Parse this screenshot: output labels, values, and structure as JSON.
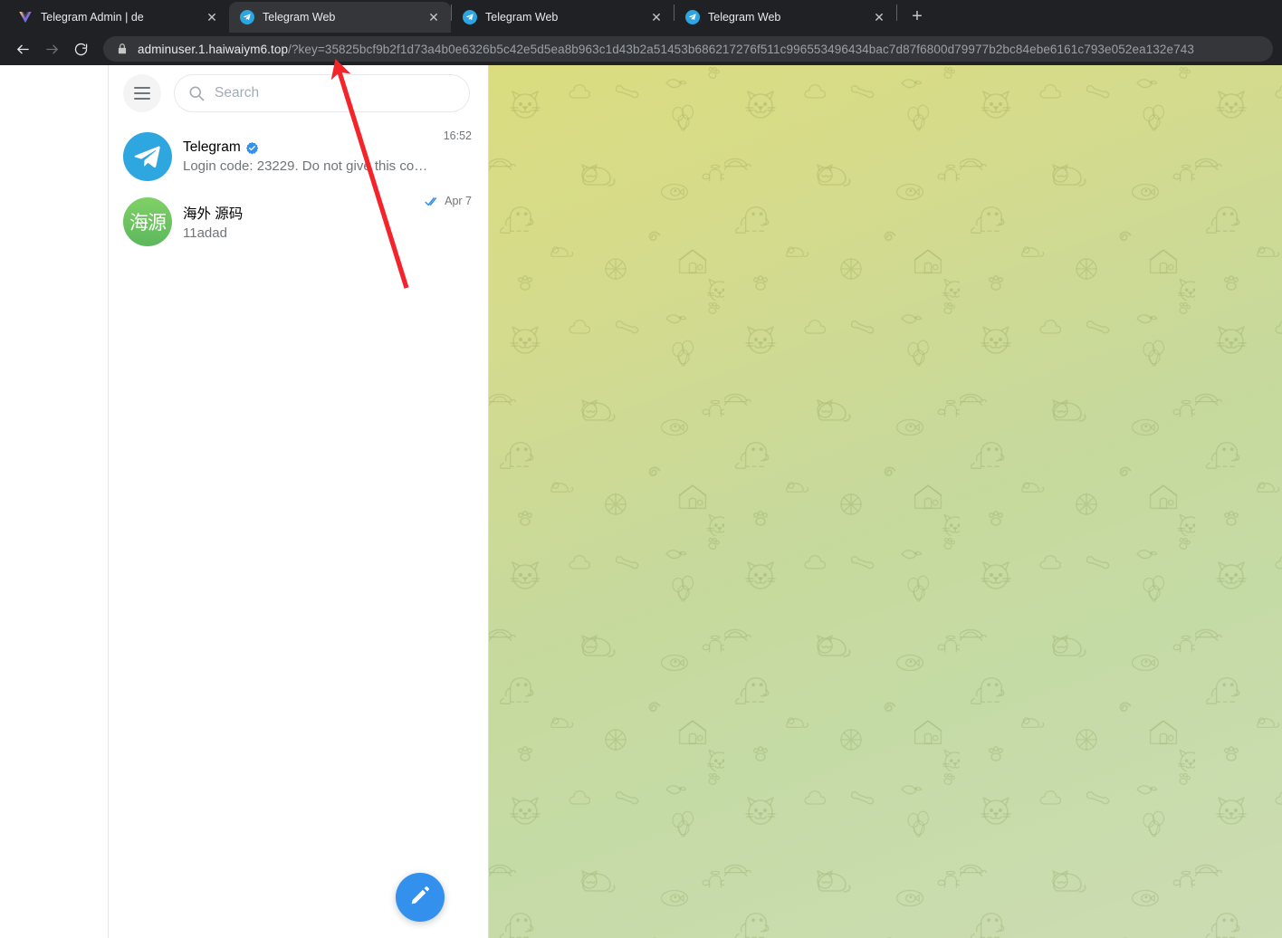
{
  "browser": {
    "tabs": [
      {
        "title": "Telegram Admin | de",
        "favicon": "vuejs-icon",
        "active": false
      },
      {
        "title": "Telegram Web",
        "favicon": "telegram-icon",
        "active": true
      },
      {
        "title": "Telegram Web",
        "favicon": "telegram-icon",
        "active": false
      },
      {
        "title": "Telegram Web",
        "favicon": "telegram-icon",
        "active": false
      }
    ],
    "new_tab_label": "+",
    "close_label": "✕",
    "nav": {
      "back": "back-arrow",
      "forward": "forward-arrow",
      "reload": "reload-icon"
    },
    "omnibox": {
      "lock": "lock-icon",
      "host": "adminuser.1.haiwaiym6.top",
      "path": "/?key=35825bcf9b2f1d73a4b0e6326b5c42e5d5ea8b963c1d43b2a51453b686217276f511c996553496434bac7d87f6800d79977b2bc84ebe6161c793e052ea132e743"
    }
  },
  "telegram": {
    "header": {
      "menu_icon": "hamburger-menu-icon",
      "search_icon": "search-icon",
      "search_value": "",
      "search_placeholder": "Search"
    },
    "chats": [
      {
        "name": "Telegram",
        "verified": true,
        "avatar_type": "telegram-logo",
        "avatar_initials": "",
        "preview": "Login code: 23229. Do not give this code to…",
        "time": "16:52",
        "read_ticks": false
      },
      {
        "name": "海外 源码",
        "verified": false,
        "avatar_type": "initials",
        "avatar_initials": "海源",
        "preview": "11adad",
        "time": "Apr 7",
        "read_ticks": true
      }
    ],
    "compose_button": {
      "icon": "pencil-icon",
      "label": "New Message"
    }
  },
  "annotation": {
    "type": "arrow",
    "color": "#f5232a",
    "points_at": "url-query-key"
  },
  "colors": {
    "browser_chrome": "#202124",
    "active_tab": "#35363a",
    "telegram_accent": "#3390ec",
    "verified_blue": "#3390ec",
    "avatar_green_top": "#80d066",
    "avatar_green_bottom": "#5cb85c",
    "chat_bg_start": "#dbdc7f",
    "chat_bg_end": "#ccdcb3",
    "annotation_red": "#f5232a"
  }
}
